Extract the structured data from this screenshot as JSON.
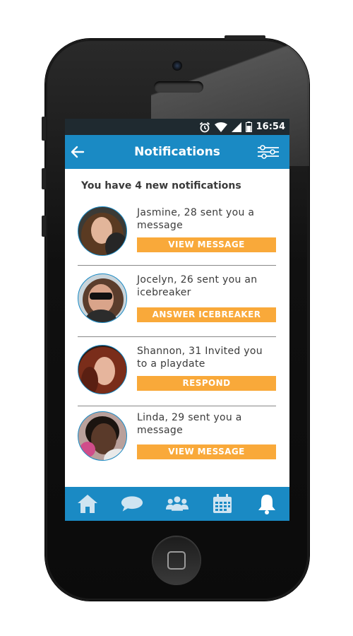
{
  "status": {
    "time": "16:54"
  },
  "header": {
    "title": "Notifications"
  },
  "summary": "You have 4 new notifications",
  "notifications": [
    {
      "message": "Jasmine, 28 sent you a message",
      "action": "VIEW MESSAGE"
    },
    {
      "message": "Jocelyn, 26 sent you an icebreaker",
      "action": "ANSWER ICEBREAKER"
    },
    {
      "message": "Shannon, 31 Invited you to a playdate",
      "action": "RESPOND"
    },
    {
      "message": "Linda, 29 sent you a message",
      "action": "VIEW MESSAGE"
    }
  ],
  "tabs": [
    "home-icon",
    "chat-icon",
    "people-icon",
    "calendar-icon",
    "bell-icon"
  ],
  "colors": {
    "primary": "#1a8ac4",
    "accent": "#f9a93a",
    "statusbar": "#1f2a30"
  }
}
